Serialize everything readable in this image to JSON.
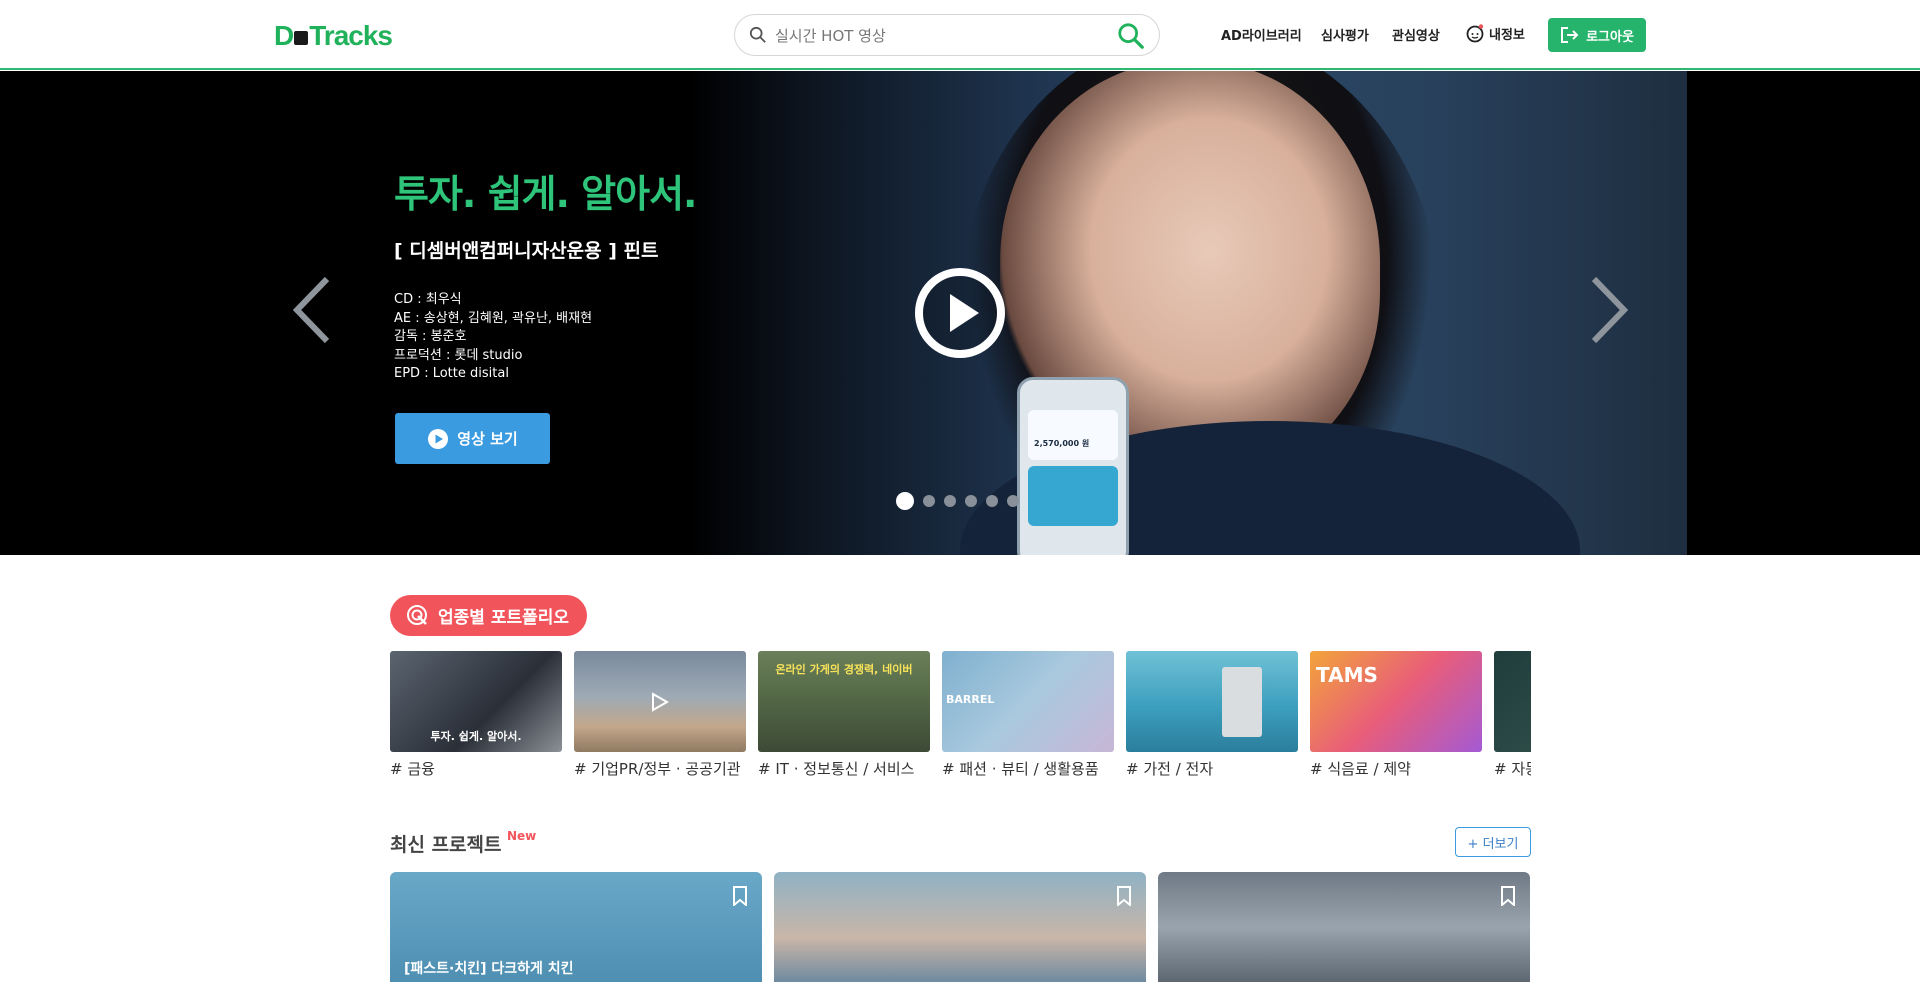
{
  "header": {
    "logo": "D-Tracks",
    "search_placeholder": "실시간 HOT 영상",
    "nav": [
      "AD라이브러리",
      "심사평가",
      "관심영상"
    ],
    "myinfo_label": "내정보",
    "logout_label": "로그아웃"
  },
  "hero": {
    "title": "투자. 쉽게. 알아서.",
    "subtitle": "[ 디셈버앤컴퍼니자산운용 ] 핀트",
    "credits": [
      "CD : 최우식",
      "AE : 송상현, 김혜원, 곽유난, 배재현",
      "감독 : 봉준호",
      "프로덕션 : 롯데 studio",
      "EPD : Lotte disital"
    ],
    "watch_label": "영상 보기",
    "phone_amount": "2,570,000 원",
    "slide_count": 6,
    "active_slide": 1
  },
  "portfolio": {
    "title": "업종별 포트폴리오",
    "categories": [
      {
        "label": "# 금융",
        "caption": "투자. 쉽게. 알아서."
      },
      {
        "label": "# 기업PR/정부 · 공공기관",
        "caption": ""
      },
      {
        "label": "# IT · 정보통신 / 서비스",
        "caption": "온라인 가게의 경쟁력, 네이버"
      },
      {
        "label": "# 패션 · 뷰티 / 생활용품",
        "caption": "BARREL"
      },
      {
        "label": "# 가전 / 전자",
        "caption": ""
      },
      {
        "label": "# 식음료 / 제약",
        "caption": "TAMS"
      },
      {
        "label": "# 자동",
        "caption": ""
      }
    ]
  },
  "latest": {
    "title": "최신 프로젝트",
    "badge": "New",
    "more_label": "+ 더보기",
    "cards": [
      {
        "caption": "[패스트·치킨] 다크하게 치킨"
      },
      {
        "caption": ""
      },
      {
        "caption": ""
      }
    ]
  },
  "colors": {
    "brand_green": "#26b36b",
    "hero_title_green": "#2ec47a",
    "watch_blue": "#3a9be0",
    "pill_red": "#f2545b"
  }
}
